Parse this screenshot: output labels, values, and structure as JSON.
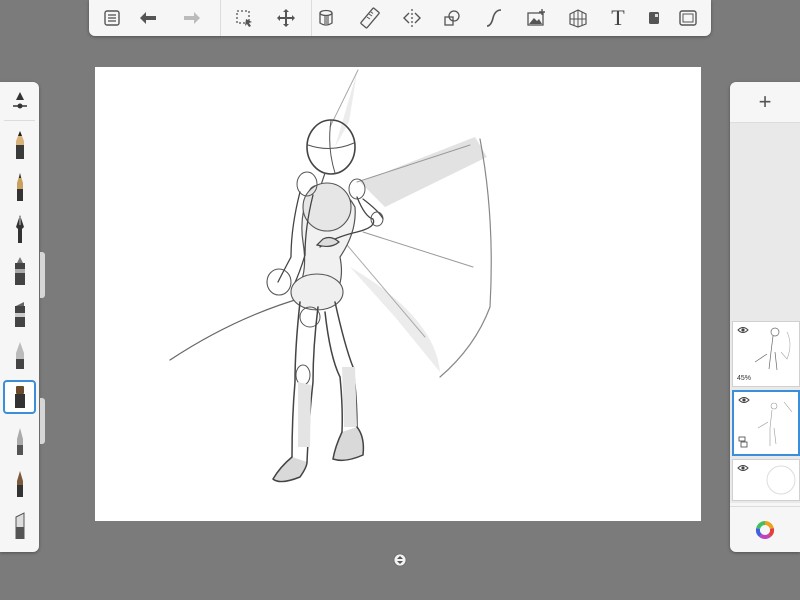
{
  "toolbar": {
    "items": [
      {
        "name": "list-icon"
      },
      {
        "name": "undo-icon"
      },
      {
        "name": "redo-icon"
      },
      {
        "name": "selection-icon"
      },
      {
        "name": "transform-icon"
      },
      {
        "name": "fill-icon"
      },
      {
        "name": "ruler-icon"
      },
      {
        "name": "symmetry-icon"
      },
      {
        "name": "shape-icon"
      },
      {
        "name": "curve-icon"
      },
      {
        "name": "image-icon"
      },
      {
        "name": "perspective-icon"
      },
      {
        "name": "text-icon",
        "glyph": "T"
      },
      {
        "name": "copic-color-icon"
      },
      {
        "name": "fullscreen-icon"
      }
    ]
  },
  "brushes": [
    {
      "name": "brush-settings-icon"
    },
    {
      "name": "pencil-icon"
    },
    {
      "name": "ballpoint-pen-icon"
    },
    {
      "name": "ink-pen-icon"
    },
    {
      "name": "marker-icon"
    },
    {
      "name": "chisel-marker-icon"
    },
    {
      "name": "airbrush-icon"
    },
    {
      "name": "paintbrush-icon",
      "selected": true
    },
    {
      "name": "soft-brush-icon"
    },
    {
      "name": "smudge-icon"
    },
    {
      "name": "eraser-icon"
    }
  ],
  "layers": {
    "add_label": "+",
    "items": [
      {
        "name": "layer-1",
        "opacity": "45%",
        "selected": false
      },
      {
        "name": "layer-2",
        "opacity": "",
        "selected": true
      },
      {
        "name": "background-layer",
        "opacity": "",
        "selected": false
      }
    ]
  },
  "colors": {
    "accent": "#3a8fd8",
    "background": "#7b7b7b",
    "panel": "#f6f6f6"
  }
}
